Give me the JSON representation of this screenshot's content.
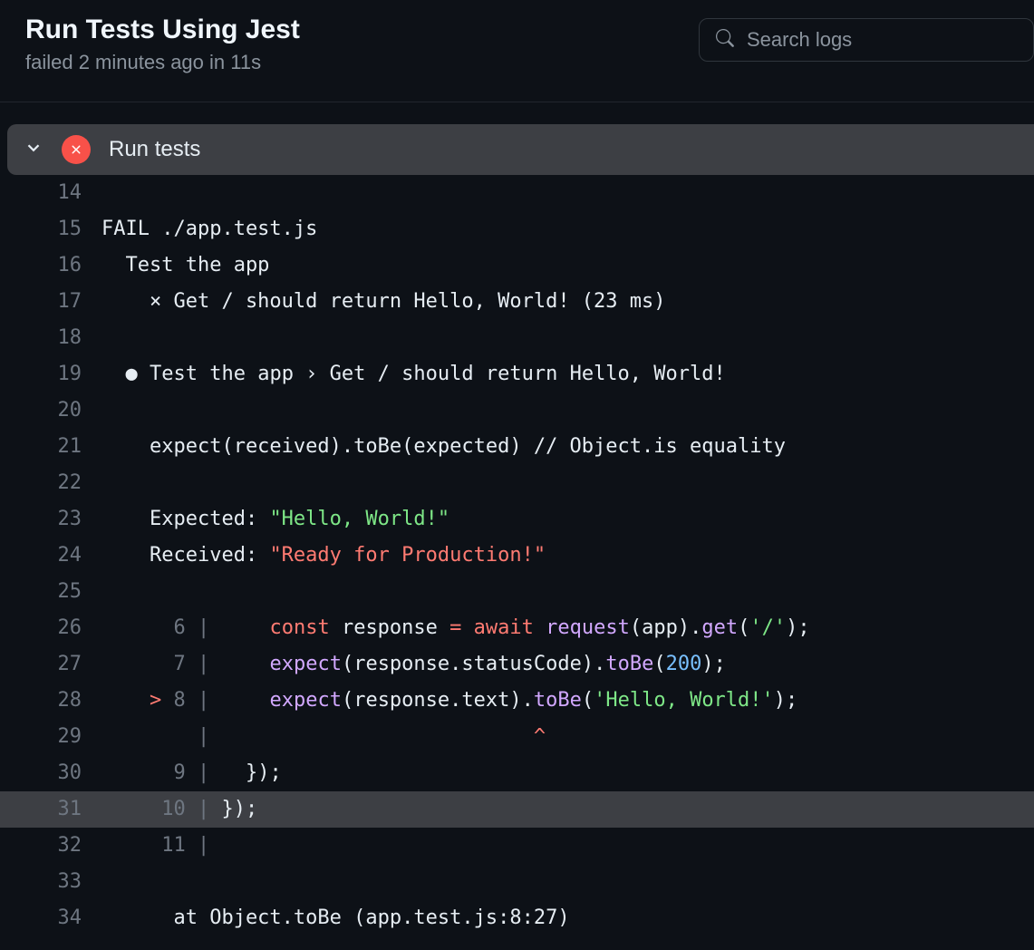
{
  "header": {
    "title": "Run Tests Using Jest",
    "status": "failed 2 minutes ago in 11s"
  },
  "search": {
    "placeholder": "Search logs"
  },
  "section": {
    "title": "Run tests"
  },
  "log": {
    "lines": [
      {
        "n": "14",
        "segs": []
      },
      {
        "n": "15",
        "segs": [
          {
            "t": "FAIL ./app.test.js"
          }
        ]
      },
      {
        "n": "16",
        "segs": [
          {
            "t": "  Test the app"
          }
        ]
      },
      {
        "n": "17",
        "segs": [
          {
            "t": "    × Get / should return Hello, World! (23 ms)"
          }
        ]
      },
      {
        "n": "18",
        "segs": []
      },
      {
        "n": "19",
        "segs": [
          {
            "t": "  "
          },
          {
            "t": "●",
            "c": "bullet"
          },
          {
            "t": " Test the app › Get / should return Hello, World!"
          }
        ]
      },
      {
        "n": "20",
        "segs": []
      },
      {
        "n": "21",
        "segs": [
          {
            "t": "    expect(received).toBe(expected) // Object.is equality"
          }
        ]
      },
      {
        "n": "22",
        "segs": []
      },
      {
        "n": "23",
        "segs": [
          {
            "t": "    Expected: "
          },
          {
            "t": "\"Hello, World!\"",
            "c": "grn"
          }
        ]
      },
      {
        "n": "24",
        "segs": [
          {
            "t": "    Received: "
          },
          {
            "t": "\"Ready for Production!\"",
            "c": "red"
          }
        ]
      },
      {
        "n": "25",
        "segs": []
      },
      {
        "n": "26",
        "segs": [
          {
            "t": "      ",
            "c": "faint"
          },
          {
            "t": "6",
            "c": "faint"
          },
          {
            "t": " |",
            "c": "faint"
          },
          {
            "t": "     "
          },
          {
            "t": "const",
            "c": "kw"
          },
          {
            "t": " response "
          },
          {
            "t": "=",
            "c": "op"
          },
          {
            "t": " "
          },
          {
            "t": "await",
            "c": "kw"
          },
          {
            "t": " "
          },
          {
            "t": "request",
            "c": "fn"
          },
          {
            "t": "(app)."
          },
          {
            "t": "get",
            "c": "fn"
          },
          {
            "t": "("
          },
          {
            "t": "'/'",
            "c": "str"
          },
          {
            "t": ");"
          }
        ]
      },
      {
        "n": "27",
        "segs": [
          {
            "t": "      ",
            "c": "faint"
          },
          {
            "t": "7",
            "c": "faint"
          },
          {
            "t": " |",
            "c": "faint"
          },
          {
            "t": "     "
          },
          {
            "t": "expect",
            "c": "fn"
          },
          {
            "t": "(response.statusCode)."
          },
          {
            "t": "toBe",
            "c": "fn"
          },
          {
            "t": "("
          },
          {
            "t": "200",
            "c": "num"
          },
          {
            "t": ");"
          }
        ]
      },
      {
        "n": "28",
        "segs": [
          {
            "t": "    "
          },
          {
            "t": ">",
            "c": "red"
          },
          {
            "t": " ",
            "c": "faint"
          },
          {
            "t": "8",
            "c": "faint"
          },
          {
            "t": " |",
            "c": "faint"
          },
          {
            "t": "     "
          },
          {
            "t": "expect",
            "c": "fn"
          },
          {
            "t": "(response.text)."
          },
          {
            "t": "toBe",
            "c": "fn"
          },
          {
            "t": "("
          },
          {
            "t": "'Hello, World!'",
            "c": "str"
          },
          {
            "t": ");"
          }
        ]
      },
      {
        "n": "29",
        "segs": [
          {
            "t": "        |",
            "c": "faint"
          },
          {
            "t": "                           "
          },
          {
            "t": "^",
            "c": "caret"
          }
        ]
      },
      {
        "n": "30",
        "segs": [
          {
            "t": "      ",
            "c": "faint"
          },
          {
            "t": "9",
            "c": "faint"
          },
          {
            "t": " |",
            "c": "faint"
          },
          {
            "t": "   });"
          }
        ]
      },
      {
        "n": "31",
        "hl": true,
        "segs": [
          {
            "t": "     ",
            "c": "faint"
          },
          {
            "t": "10",
            "c": "faint"
          },
          {
            "t": " |",
            "c": "faint"
          },
          {
            "t": " });"
          }
        ]
      },
      {
        "n": "32",
        "segs": [
          {
            "t": "     ",
            "c": "faint"
          },
          {
            "t": "11",
            "c": "faint"
          },
          {
            "t": " |",
            "c": "faint"
          }
        ]
      },
      {
        "n": "33",
        "segs": []
      },
      {
        "n": "34",
        "segs": [
          {
            "t": "      at Object.toBe (app.test.js:8:27)"
          }
        ]
      }
    ]
  }
}
